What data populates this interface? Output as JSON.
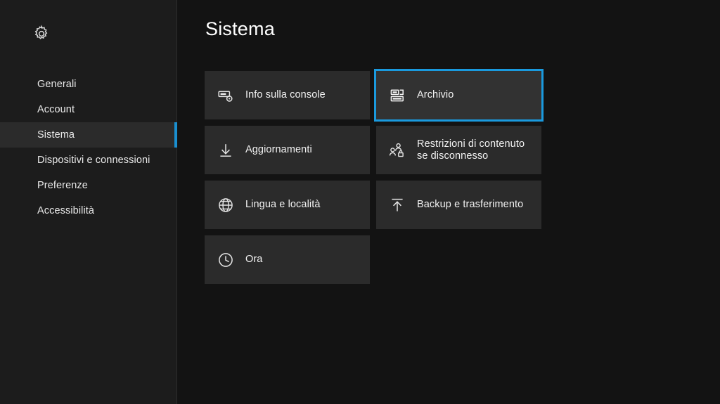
{
  "window": {
    "background_color": "#111111",
    "accent_color": "#1a9ade"
  },
  "sidebar": {
    "header_icon": "gear-icon",
    "items": [
      {
        "label": "Generali",
        "selected": false
      },
      {
        "label": "Account",
        "selected": false
      },
      {
        "label": "Sistema",
        "selected": true
      },
      {
        "label": "Dispositivi e connessioni",
        "selected": false
      },
      {
        "label": "Preferenze",
        "selected": false
      },
      {
        "label": "Accessibilità",
        "selected": false
      }
    ]
  },
  "main": {
    "title": "Sistema",
    "tiles_left": [
      {
        "label": "Info sulla console",
        "icon": "console-icon",
        "focused": false
      },
      {
        "label": "Aggiornamenti",
        "icon": "download-arrow-icon",
        "focused": false
      },
      {
        "label": "Lingua e località",
        "icon": "globe-icon",
        "focused": false
      },
      {
        "label": "Ora",
        "icon": "clock-icon",
        "focused": false
      }
    ],
    "tiles_right": [
      {
        "label": "Archivio",
        "icon": "storage-icon",
        "focused": true
      },
      {
        "label": "Restrizioni di contenuto\nse disconnesso",
        "icon": "people-lock-icon",
        "focused": false
      },
      {
        "label": "Backup e trasferimento",
        "icon": "upload-arrow-icon",
        "focused": false
      }
    ]
  }
}
